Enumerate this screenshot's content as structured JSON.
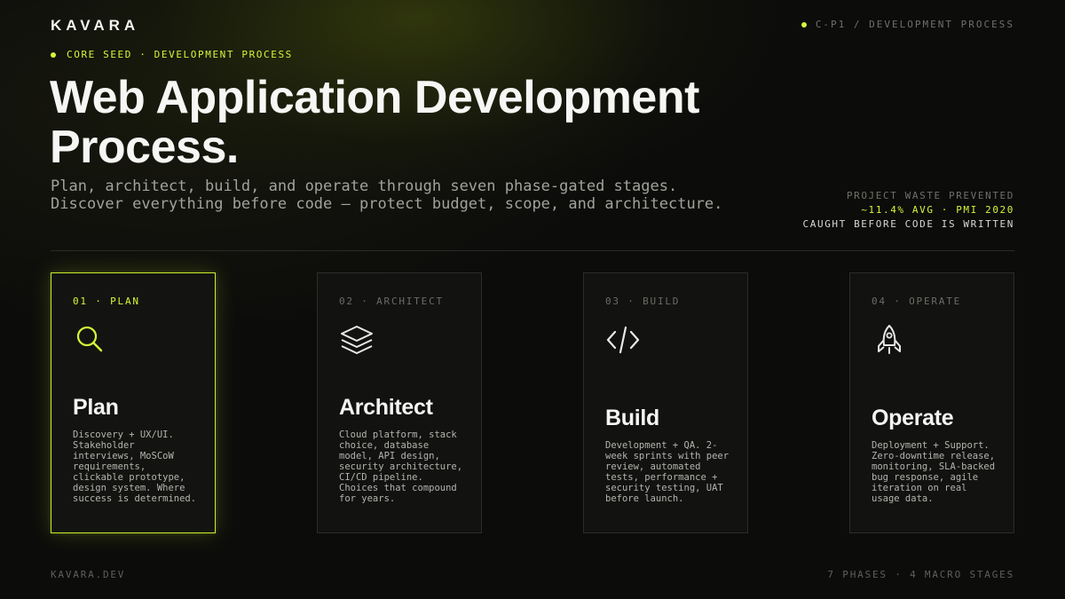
{
  "brand": "KAVARA",
  "header": {
    "section_code": "C-P1 / DEVELOPMENT PROCESS"
  },
  "eyebrow": "CORE SEED · DEVELOPMENT PROCESS",
  "title": "Web Application Development Process.",
  "subtitle": "Plan, architect, build, and operate through seven phase-gated stages. Discover everything before code — protect budget, scope, and architecture.",
  "stat": {
    "label": "PROJECT WASTE PREVENTED",
    "value": "~11.4% AVG · PMI 2020",
    "note": "CAUGHT BEFORE CODE IS WRITTEN"
  },
  "cards": [
    {
      "step": "01 · PLAN",
      "icon": "search-icon",
      "title": "Plan",
      "desc": "Discovery + UX/UI. Stakeholder interviews, MoSCoW requirements, clickable prototype, design system. Where success is determined.",
      "active": true
    },
    {
      "step": "02 · ARCHITECT",
      "icon": "layers-icon",
      "title": "Architect",
      "desc": "Cloud platform, stack choice, database model, API design, security architecture, CI/CD pipeline. Choices that compound for years.",
      "active": false
    },
    {
      "step": "03 · BUILD",
      "icon": "code-icon",
      "title": "Build",
      "desc": "Development + QA. 2-week sprints with peer review, automated tests, performance + security testing, UAT before launch.",
      "active": false
    },
    {
      "step": "04 · OPERATE",
      "icon": "rocket-icon",
      "title": "Operate",
      "desc": "Deployment + Support. Zero-downtime release, monitoring, SLA-backed bug response, agile iteration on real usage data.",
      "active": false
    }
  ],
  "footer": {
    "site": "KAVARA.DEV",
    "summary": "7 PHASES · 4 MACRO STAGES"
  },
  "colors": {
    "accent": "#d6f53a",
    "background": "#0c0c0b",
    "card_border": "#2c2c29"
  }
}
